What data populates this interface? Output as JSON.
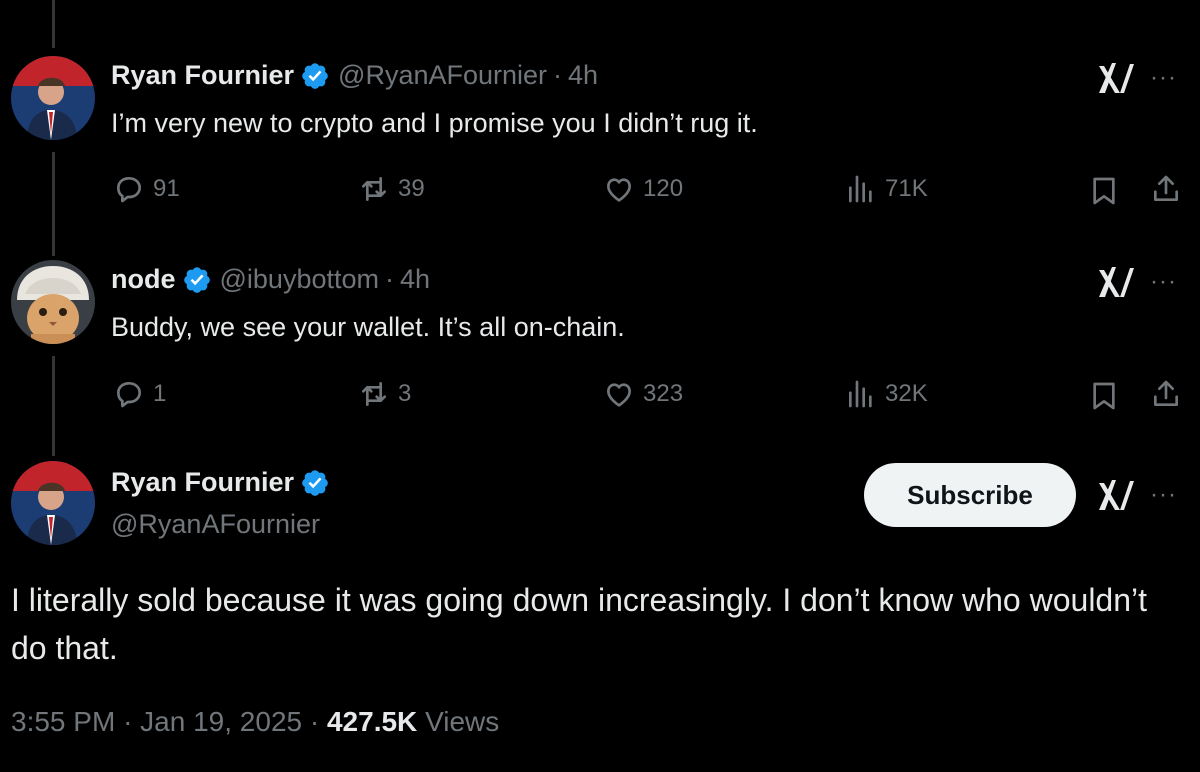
{
  "tweets": [
    {
      "name": "Ryan Fournier",
      "handle": "@RyanAFournier",
      "separator": "·",
      "time": "4h",
      "text": "I’m very new to crypto and I promise you I didn’t rug it.",
      "replies": "91",
      "reposts": "39",
      "likes": "120",
      "views": "71K"
    },
    {
      "name": "node",
      "handle": "@ibuybottom",
      "separator": "·",
      "time": "4h",
      "text": "Buddy, we see your wallet. It’s all on-chain.",
      "replies": "1",
      "reposts": "3",
      "likes": "323",
      "views": "32K"
    }
  ],
  "main": {
    "name": "Ryan Fournier",
    "handle": "@RyanAFournier",
    "subscribe_label": "Subscribe",
    "text": "I literally sold because it was going down increasingly. I don’t know who wouldn’t do that.",
    "time": "3:55 PM",
    "separator": "·",
    "date": "Jan 19, 2025",
    "views_count": "427.5K",
    "views_label": "Views"
  },
  "more_label": "···",
  "icons": {
    "verified": "verified-badge-icon",
    "grok": "grok-icon",
    "reply": "reply-icon",
    "repost": "repost-icon",
    "like": "like-icon",
    "views": "views-icon",
    "bookmark": "bookmark-icon",
    "share": "share-icon"
  },
  "colors": {
    "background": "#000000",
    "text": "#e7e9ea",
    "secondary": "#71767b",
    "verified": "#1d9bf0",
    "subscribe_bg": "#eff3f4"
  }
}
